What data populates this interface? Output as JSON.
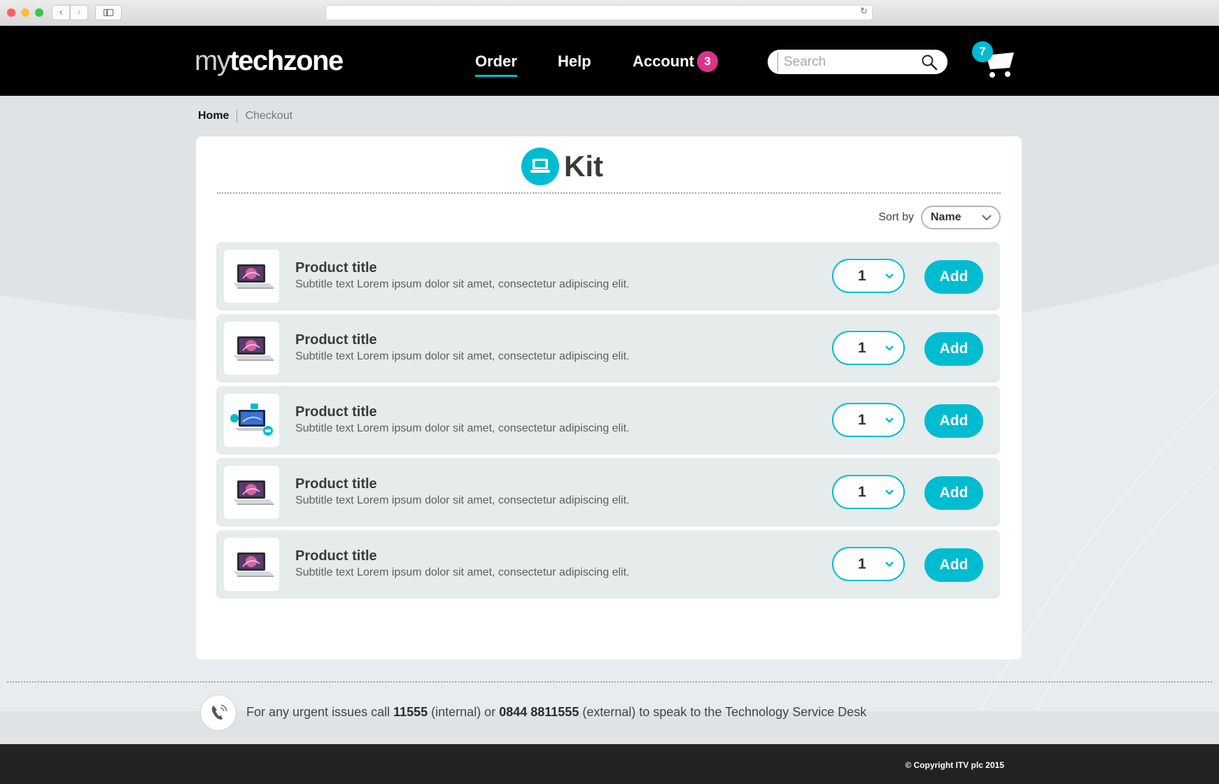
{
  "brand": {
    "logo_light": "my",
    "logo_bold": "techzone"
  },
  "nav": {
    "order": "Order",
    "help": "Help",
    "account": "Account",
    "account_badge": "3",
    "cart_badge": "7"
  },
  "search": {
    "placeholder": "Search"
  },
  "breadcrumb": {
    "home": "Home",
    "checkout": "Checkout"
  },
  "page": {
    "title": "Kit",
    "sort_label": "Sort by",
    "sort_value": "Name"
  },
  "products": [
    {
      "title": "Product title",
      "subtitle": "Subtitle text Lorem ipsum dolor sit amet, consectetur adipiscing elit.",
      "qty": "1",
      "add_label": "Add",
      "image": "laptop-image"
    },
    {
      "title": "Product title",
      "subtitle": "Subtitle text Lorem ipsum dolor sit amet, consectetur adipiscing elit.",
      "qty": "1",
      "add_label": "Add",
      "image": "laptop-image"
    },
    {
      "title": "Product title",
      "subtitle": "Subtitle text Lorem ipsum dolor sit amet, consectetur adipiscing elit.",
      "qty": "1",
      "add_label": "Add",
      "image": "laptop-bundle-image"
    },
    {
      "title": "Product title",
      "subtitle": "Subtitle text Lorem ipsum dolor sit amet, consectetur adipiscing elit.",
      "qty": "1",
      "add_label": "Add",
      "image": "laptop-image"
    },
    {
      "title": "Product title",
      "subtitle": "Subtitle text Lorem ipsum dolor sit amet, consectetur adipiscing elit.",
      "qty": "1",
      "add_label": "Add",
      "image": "laptop-image"
    }
  ],
  "footer": {
    "text_1": "For any urgent issues call ",
    "internal_number": "11555",
    "text_2": " (internal) or ",
    "external_number": "0844 8811555",
    "text_3": " (external) to speak to the Technology Service Desk",
    "copyright": "© Copyright ITV plc 2015"
  },
  "colors": {
    "accent": "#00bcd0",
    "badge_pink": "#d9348b",
    "header_bg": "#000000",
    "row_bg": "#e6ebec"
  }
}
